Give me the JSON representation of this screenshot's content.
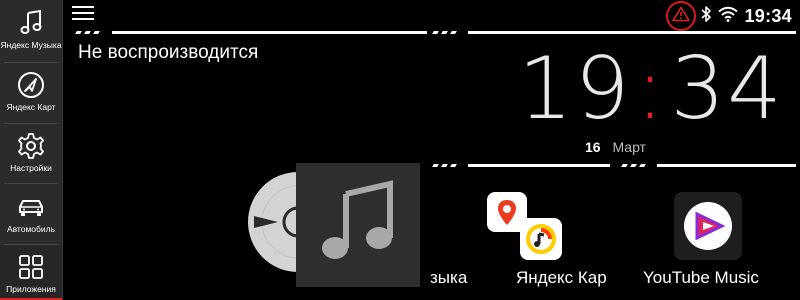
{
  "sidebar": {
    "items": [
      {
        "label": "Яндекс Музыка",
        "icon": "music-note-icon"
      },
      {
        "label": "Яндекс Карт",
        "icon": "navigation-arrow-icon"
      },
      {
        "label": "Настройки",
        "icon": "gear-icon"
      },
      {
        "label": "Автомобиль",
        "icon": "car-icon"
      },
      {
        "label": "Приложения",
        "icon": "apps-grid-icon",
        "active": true
      }
    ]
  },
  "status_bar": {
    "time": "19:34",
    "icons": [
      "warning-icon",
      "bluetooth-icon",
      "wifi-icon"
    ]
  },
  "media": {
    "status": "Не воспроизводится",
    "album_icon": "music-note-icon"
  },
  "clock_widget": {
    "hours": "19",
    "separator": ":",
    "minutes": "34",
    "day": "16",
    "month": "Март"
  },
  "apps": [
    {
      "label": "зыка"
    },
    {
      "label": "Яндекс Кар"
    },
    {
      "label": "YouTube Music"
    }
  ],
  "colors": {
    "accent": "#e02020",
    "sidebar_bg": "#2b2b2b",
    "background": "#000000"
  }
}
